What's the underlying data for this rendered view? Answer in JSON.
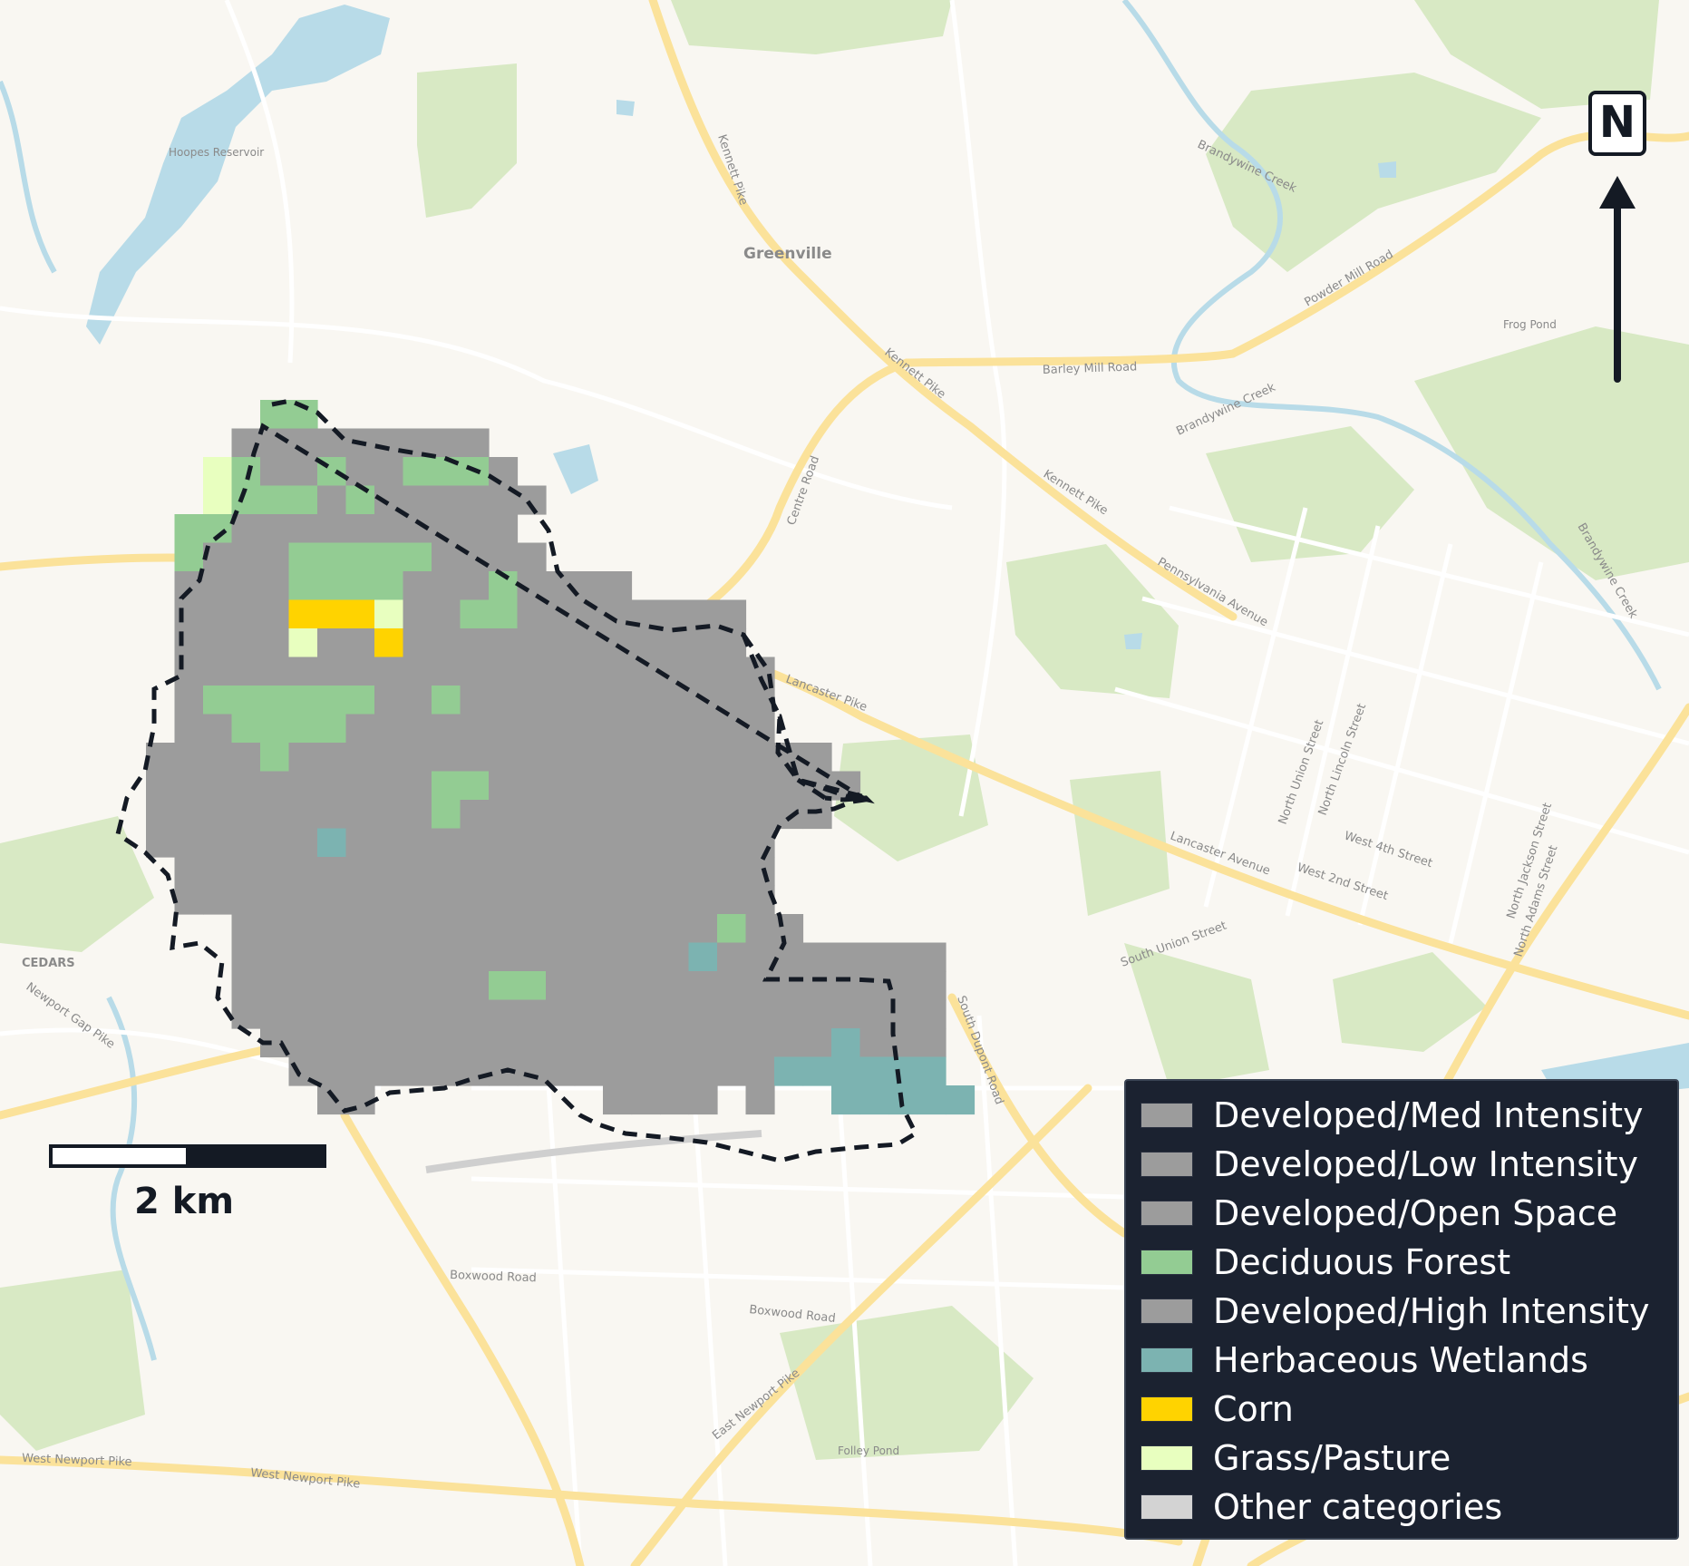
{
  "map": {
    "place_labels": [
      {
        "text": "Greenville",
        "name": "label-greenville"
      },
      {
        "text": "Hoopes Reservoir",
        "name": "label-hoopes-reservoir"
      },
      {
        "text": "Frog Pond",
        "name": "label-frog-pond"
      },
      {
        "text": "CEDARS",
        "name": "label-cedars"
      },
      {
        "text": "Folley Pond",
        "name": "label-folley-pond"
      }
    ],
    "road_labels": [
      {
        "text": "Kennett Pike",
        "name": "label-kennett-pike-north"
      },
      {
        "text": "Powder Mill Road",
        "name": "label-powder-mill-road"
      },
      {
        "text": "Barley Mill Road",
        "name": "label-barley-mill-road"
      },
      {
        "text": "Kennett Pike",
        "name": "label-kennett-pike-mid"
      },
      {
        "text": "Kennett Pike",
        "name": "label-kennett-pike-south"
      },
      {
        "text": "Centre Road",
        "name": "label-centre-road"
      },
      {
        "text": "Pennsylvania Avenue",
        "name": "label-pennsylvania-avenue"
      },
      {
        "text": "Lancaster Pike",
        "name": "label-lancaster-pike"
      },
      {
        "text": "Lancaster Avenue",
        "name": "label-lancaster-avenue"
      },
      {
        "text": "West 4th Street",
        "name": "label-west-4th-street"
      },
      {
        "text": "West 2nd Street",
        "name": "label-west-2nd-street"
      },
      {
        "text": "North Union Street",
        "name": "label-north-union-street"
      },
      {
        "text": "North Lincoln Street",
        "name": "label-north-lincoln-street"
      },
      {
        "text": "South Union Street",
        "name": "label-south-union-street"
      },
      {
        "text": "North Jackson Street",
        "name": "label-north-jackson-street"
      },
      {
        "text": "North Adams Street",
        "name": "label-north-adams-street"
      },
      {
        "text": "South Dupont Road",
        "name": "label-south-dupont-road"
      },
      {
        "text": "Newport Gap Pike",
        "name": "label-newport-gap-pike"
      },
      {
        "text": "Boxwood Road",
        "name": "label-boxwood-road-1"
      },
      {
        "text": "Boxwood Road",
        "name": "label-boxwood-road-2"
      },
      {
        "text": "East Newport Pike",
        "name": "label-east-newport-pike"
      },
      {
        "text": "West Newport Pike",
        "name": "label-west-newport-pike-1"
      },
      {
        "text": "West Newport Pike",
        "name": "label-west-newport-pike-2"
      },
      {
        "text": "Brandywine Creek",
        "name": "label-brandywine-creek-1"
      },
      {
        "text": "Brandywine Creek",
        "name": "label-brandywine-creek-2"
      },
      {
        "text": "Brandywine Creek",
        "name": "label-brandywine-creek-3"
      }
    ],
    "colors": {
      "background": "#f9f7f2",
      "park": "#d8e9c4",
      "water": "#b8dbe8",
      "major_road": "#fbe29a",
      "minor_road": "#ffffff"
    }
  },
  "legend": {
    "items": [
      {
        "label": "Developed/Med Intensity",
        "color": "#9c9c9c"
      },
      {
        "label": "Developed/Low Intensity",
        "color": "#9c9c9c"
      },
      {
        "label": "Developed/Open Space",
        "color": "#9c9c9c"
      },
      {
        "label": "Deciduous Forest",
        "color": "#93cc93"
      },
      {
        "label": "Developed/High Intensity",
        "color": "#9c9c9c"
      },
      {
        "label": "Herbaceous Wetlands",
        "color": "#7cb3b1"
      },
      {
        "label": "Corn",
        "color": "#ffd300"
      },
      {
        "label": "Grass/Pasture",
        "color": "#e8ffbf"
      },
      {
        "label": "Other categories",
        "color": "#d3d3d3"
      }
    ]
  },
  "north_arrow": {
    "label": "N"
  },
  "scale_bar": {
    "label": "2 km"
  },
  "land_cover": {
    "developed_color": "#9c9c9c",
    "forest_color": "#93cc93",
    "wetland_color": "#7cb3b1",
    "corn_color": "#ffd300",
    "pasture_color": "#e8ffbf"
  }
}
